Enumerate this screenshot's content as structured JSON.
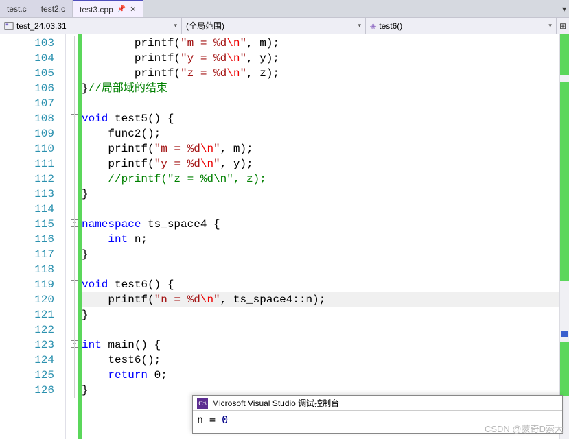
{
  "tabs": [
    {
      "label": "test.c",
      "active": false
    },
    {
      "label": "test2.c",
      "active": false
    },
    {
      "label": "test3.cpp",
      "active": true
    }
  ],
  "navbar": {
    "project": "test_24.03.31",
    "scope": "(全局范围)",
    "member": "test6()"
  },
  "gutter_start": 103,
  "code_lines": [
    {
      "n": 103,
      "html": "        printf(<s>\"m = %d</s><e>\\n</e><s>\"</s>, m);"
    },
    {
      "n": 104,
      "html": "        printf(<s>\"y = %d</s><e>\\n</e><s>\"</s>, y);"
    },
    {
      "n": 105,
      "html": "        printf(<s>\"z = %d</s><e>\\n</e><s>\"</s>, z);"
    },
    {
      "n": 106,
      "html": "}<c>//局部域的结束</c>"
    },
    {
      "n": 107,
      "html": ""
    },
    {
      "n": 108,
      "fold": "-",
      "html": "<k>void</k> test5() {"
    },
    {
      "n": 109,
      "html": "    func2();"
    },
    {
      "n": 110,
      "html": "    printf(<s>\"m = %d</s><e>\\n</e><s>\"</s>, m);"
    },
    {
      "n": 111,
      "html": "    printf(<s>\"y = %d</s><e>\\n</e><s>\"</s>, y);"
    },
    {
      "n": 112,
      "html": "    <c>//printf(\"z = %d\\n\", z);</c>"
    },
    {
      "n": 113,
      "html": "}"
    },
    {
      "n": 114,
      "html": ""
    },
    {
      "n": 115,
      "fold": "-",
      "html": "<k>namespace</k> ts_space4 {"
    },
    {
      "n": 116,
      "html": "    <k>int</k> n;"
    },
    {
      "n": 117,
      "html": "}"
    },
    {
      "n": 118,
      "html": ""
    },
    {
      "n": 119,
      "fold": "-",
      "html": "<k>void</k> test6() {"
    },
    {
      "n": 120,
      "hl": true,
      "html": "    printf(<s>\"n = %d</s><e>\\n</e><s>\"</s>, ts_space4::n);"
    },
    {
      "n": 121,
      "html": "}"
    },
    {
      "n": 122,
      "html": ""
    },
    {
      "n": 123,
      "fold": "-",
      "html": "<k>int</k> main() {"
    },
    {
      "n": 124,
      "html": "    test6();"
    },
    {
      "n": 125,
      "html": "    <k>return</k> 0;"
    },
    {
      "n": 126,
      "html": "}"
    }
  ],
  "console": {
    "title": "Microsoft Visual Studio 调试控制台",
    "output_label": "n = ",
    "output_value": "0"
  },
  "watermark": "CSDN @蒙奇D索大"
}
